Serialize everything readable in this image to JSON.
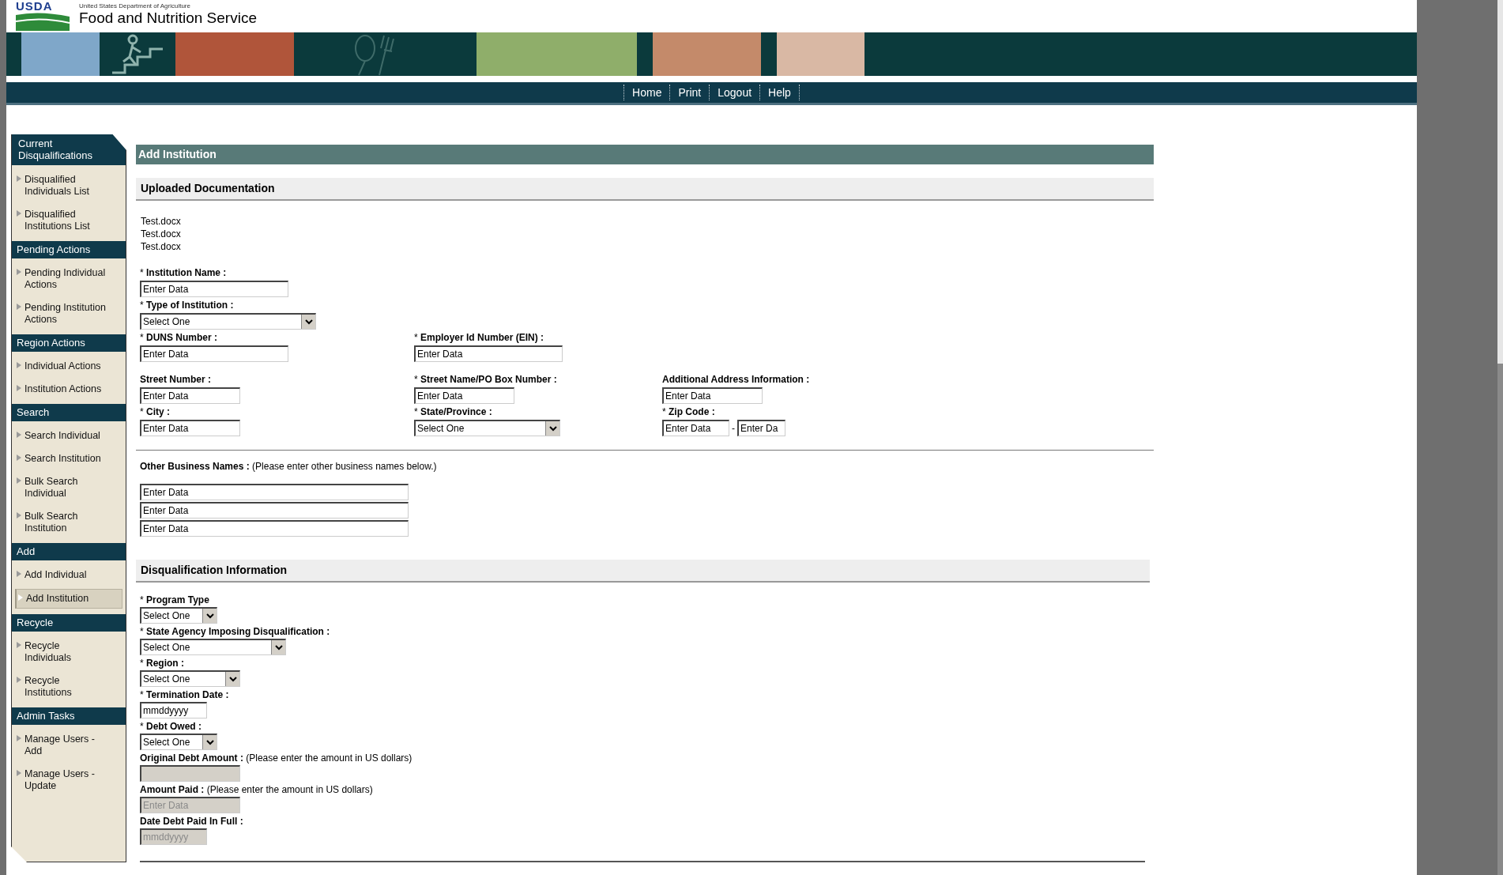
{
  "header": {
    "logo_text": "USDA",
    "agency": "United States Department of Agriculture",
    "service": "Food and Nutrition Service"
  },
  "nav": [
    "Home",
    "Print",
    "Logout",
    "Help"
  ],
  "sidebar": [
    {
      "title": "Current Disqualifications",
      "items": [
        {
          "label": "Disqualified Individuals List",
          "selected": false
        },
        {
          "label": "Disqualified Institutions List",
          "selected": false
        }
      ]
    },
    {
      "title": "Pending Actions",
      "items": [
        {
          "label": "Pending Individual Actions",
          "selected": false
        },
        {
          "label": "Pending Institution Actions",
          "selected": false
        }
      ]
    },
    {
      "title": "Region Actions",
      "items": [
        {
          "label": "Individual Actions",
          "selected": false
        },
        {
          "label": "Institution Actions",
          "selected": false
        }
      ]
    },
    {
      "title": "Search",
      "items": [
        {
          "label": "Search Individual",
          "selected": false
        },
        {
          "label": "Search Institution",
          "selected": false
        },
        {
          "label": "Bulk Search Individual",
          "selected": false
        },
        {
          "label": "Bulk Search Institution",
          "selected": false
        }
      ]
    },
    {
      "title": "Add",
      "items": [
        {
          "label": "Add Individual",
          "selected": false
        },
        {
          "label": "Add Institution",
          "selected": true
        }
      ]
    },
    {
      "title": "Recycle",
      "items": [
        {
          "label": "Recycle Individuals",
          "selected": false
        },
        {
          "label": "Recycle Institutions",
          "selected": false
        }
      ]
    },
    {
      "title": "Admin Tasks",
      "items": [
        {
          "label": "Manage Users - Add",
          "selected": false
        },
        {
          "label": "Manage Users - Update",
          "selected": false
        }
      ]
    }
  ],
  "page_title": "Add Institution",
  "uploaded": {
    "title": "Uploaded Documentation",
    "files": [
      "Test.docx",
      "Test.docx",
      "Test.docx"
    ]
  },
  "identity_rows": [
    [
      {
        "marker": "*",
        "label": "Institution Name :",
        "kind": "text",
        "value": "Enter Data"
      }
    ],
    [
      {
        "marker": "*",
        "label": "Type of Institution :",
        "kind": "select",
        "value": "Select One"
      }
    ],
    [
      {
        "marker": "*",
        "label": "DUNS Number :",
        "kind": "text",
        "value": "Enter Data"
      },
      {
        "marker": "*",
        "label": "Employer Id Number (EIN) :",
        "kind": "text",
        "value": "Enter Data"
      }
    ]
  ],
  "address_rows": [
    [
      {
        "label": "Street Number :",
        "kind": "text",
        "value": "Enter Data"
      },
      {
        "marker": "*",
        "label": "Street Name/PO Box Number :",
        "kind": "text",
        "value": "Enter Data"
      },
      {
        "label": "Additional Address Information :",
        "kind": "text",
        "value": "Enter Data"
      }
    ],
    [
      {
        "marker": "*",
        "label": "City :",
        "kind": "text",
        "value": "Enter Data"
      },
      {
        "marker": "*",
        "label": "State/Province :",
        "kind": "select",
        "value": "Select One"
      },
      {
        "marker": "*",
        "label": "Zip Code :",
        "kind": "zip",
        "separator": "-",
        "inputs": [
          {
            "value": "Enter Data"
          },
          {
            "value": "Enter Da"
          }
        ]
      }
    ]
  ],
  "other_names": {
    "label": "Other Business Names :",
    "hint": "(Please enter other business names below.)",
    "inputs": [
      {
        "value": "Enter Data"
      },
      {
        "value": "Enter Data"
      },
      {
        "value": "Enter Data"
      }
    ]
  },
  "disqualification": {
    "title": "Disqualification Information",
    "fields": [
      {
        "marker": "*",
        "label": "Program Type",
        "kind": "select",
        "value": "Select One"
      },
      {
        "marker": "*",
        "label": "State Agency Imposing Disqualification :",
        "kind": "select",
        "value": "Select One"
      },
      {
        "marker": "*",
        "label": "Region :",
        "kind": "select",
        "value": "Select One"
      },
      {
        "marker": "*",
        "label": "Termination Date :",
        "kind": "text",
        "value": "mmddyyyy",
        "disabled": false
      },
      {
        "marker": "*",
        "label": "Debt Owed :",
        "kind": "select",
        "value": "Select One"
      },
      {
        "label": "Original Debt Amount :",
        "hint": "(Please enter the amount in US dollars)",
        "kind": "text",
        "disabled": true
      },
      {
        "label": "Amount Paid :",
        "hint": "(Please enter the amount in US dollars)",
        "kind": "text",
        "disabled": true,
        "placeholder": "Enter Data"
      },
      {
        "label": "Date Debt Paid In Full :",
        "kind": "text",
        "disabled": true,
        "placeholder": "mmddyyyy"
      }
    ]
  }
}
